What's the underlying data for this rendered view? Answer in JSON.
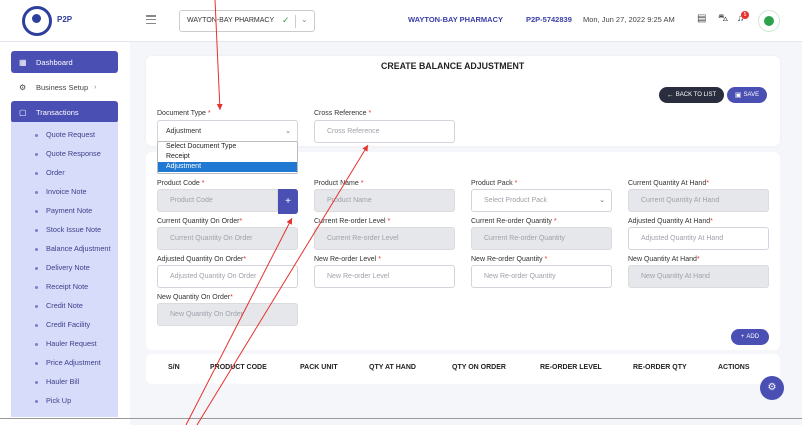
{
  "header": {
    "logo_text": "P2P",
    "pharmacy_select": "WAYTON-BAY PHARMACY",
    "org_name": "WAYTON-BAY PHARMACY",
    "org_code": "P2P-5742839",
    "datetime": "Mon, Jun 27, 2022 9:25 AM",
    "notification_count": "5"
  },
  "sidebar": {
    "dashboard": "Dashboard",
    "business_setup": "Business Setup",
    "transactions": "Transactions",
    "items": [
      "Quote Request",
      "Quote Response",
      "Order",
      "Invoice Note",
      "Payment Note",
      "Stock Issue Note",
      "Balance Adjustment",
      "Delivery Note",
      "Receipt Note",
      "Credit Note",
      "Credit Facility",
      "Hauler Request",
      "Price Adjustment",
      "Hauler Bill",
      "Pick Up"
    ]
  },
  "form": {
    "title": "CREATE BALANCE ADJUSTMENT",
    "back_label": "BACK TO LIST",
    "save_label": "SAVE",
    "document_type_label": "Document Type",
    "document_type_value": "Adjustment",
    "cross_ref_label": "Cross Reference",
    "cross_ref_placeholder": "Cross Reference",
    "document_options": [
      "Select Document Type",
      "Receipt",
      "Adjustment"
    ],
    "fields": {
      "product_code": {
        "label": "Product Code",
        "placeholder": "Product Code"
      },
      "product_name": {
        "label": "Product Name",
        "placeholder": "Product Name"
      },
      "product_pack": {
        "label": "Product Pack",
        "placeholder": "Select Product Pack"
      },
      "current_qty_hand": {
        "label": "Current Quantity At Hand",
        "placeholder": "Current Quantity At Hand"
      },
      "current_qty_order": {
        "label": "Current Quantity On Order",
        "placeholder": "Current Quantity On Order"
      },
      "current_reorder_level": {
        "label": "Current Re-order Level",
        "placeholder": "Current Re-order Level"
      },
      "current_reorder_qty": {
        "label": "Current Re-order Quantity",
        "placeholder": "Current Re-order Quantity"
      },
      "adjusted_qty_hand": {
        "label": "Adjusted Quantity At Hand",
        "placeholder": "Adjusted Quantity At Hand"
      },
      "adjusted_qty_order": {
        "label": "Adjusted Quantity On Order",
        "placeholder": "Adjusted Quantity On Order"
      },
      "new_reorder_level": {
        "label": "New Re-order Level",
        "placeholder": "New Re-order Level"
      },
      "new_reorder_qty": {
        "label": "New Re-order Quantity",
        "placeholder": "New Re-order Quantity"
      },
      "new_qty_hand": {
        "label": "New Quantity At Hand",
        "placeholder": "New Quantity At Hand"
      },
      "new_qty_order": {
        "label": "New Quantity On Order",
        "placeholder": "New Quantity On Order"
      }
    },
    "add_label": "ADD"
  },
  "table": {
    "columns": [
      "S/N",
      "PRODUCT CODE",
      "PACK UNIT",
      "QTY AT HAND",
      "QTY ON ORDER",
      "RE-ORDER LEVEL",
      "RE-ORDER QTY",
      "ACTIONS"
    ]
  },
  "colors": {
    "accent": "#4a4fb3",
    "submenu_bg": "#d7dcfa",
    "annotation_arrow": "#e5322d",
    "selected_option": "#1f78d1"
  }
}
